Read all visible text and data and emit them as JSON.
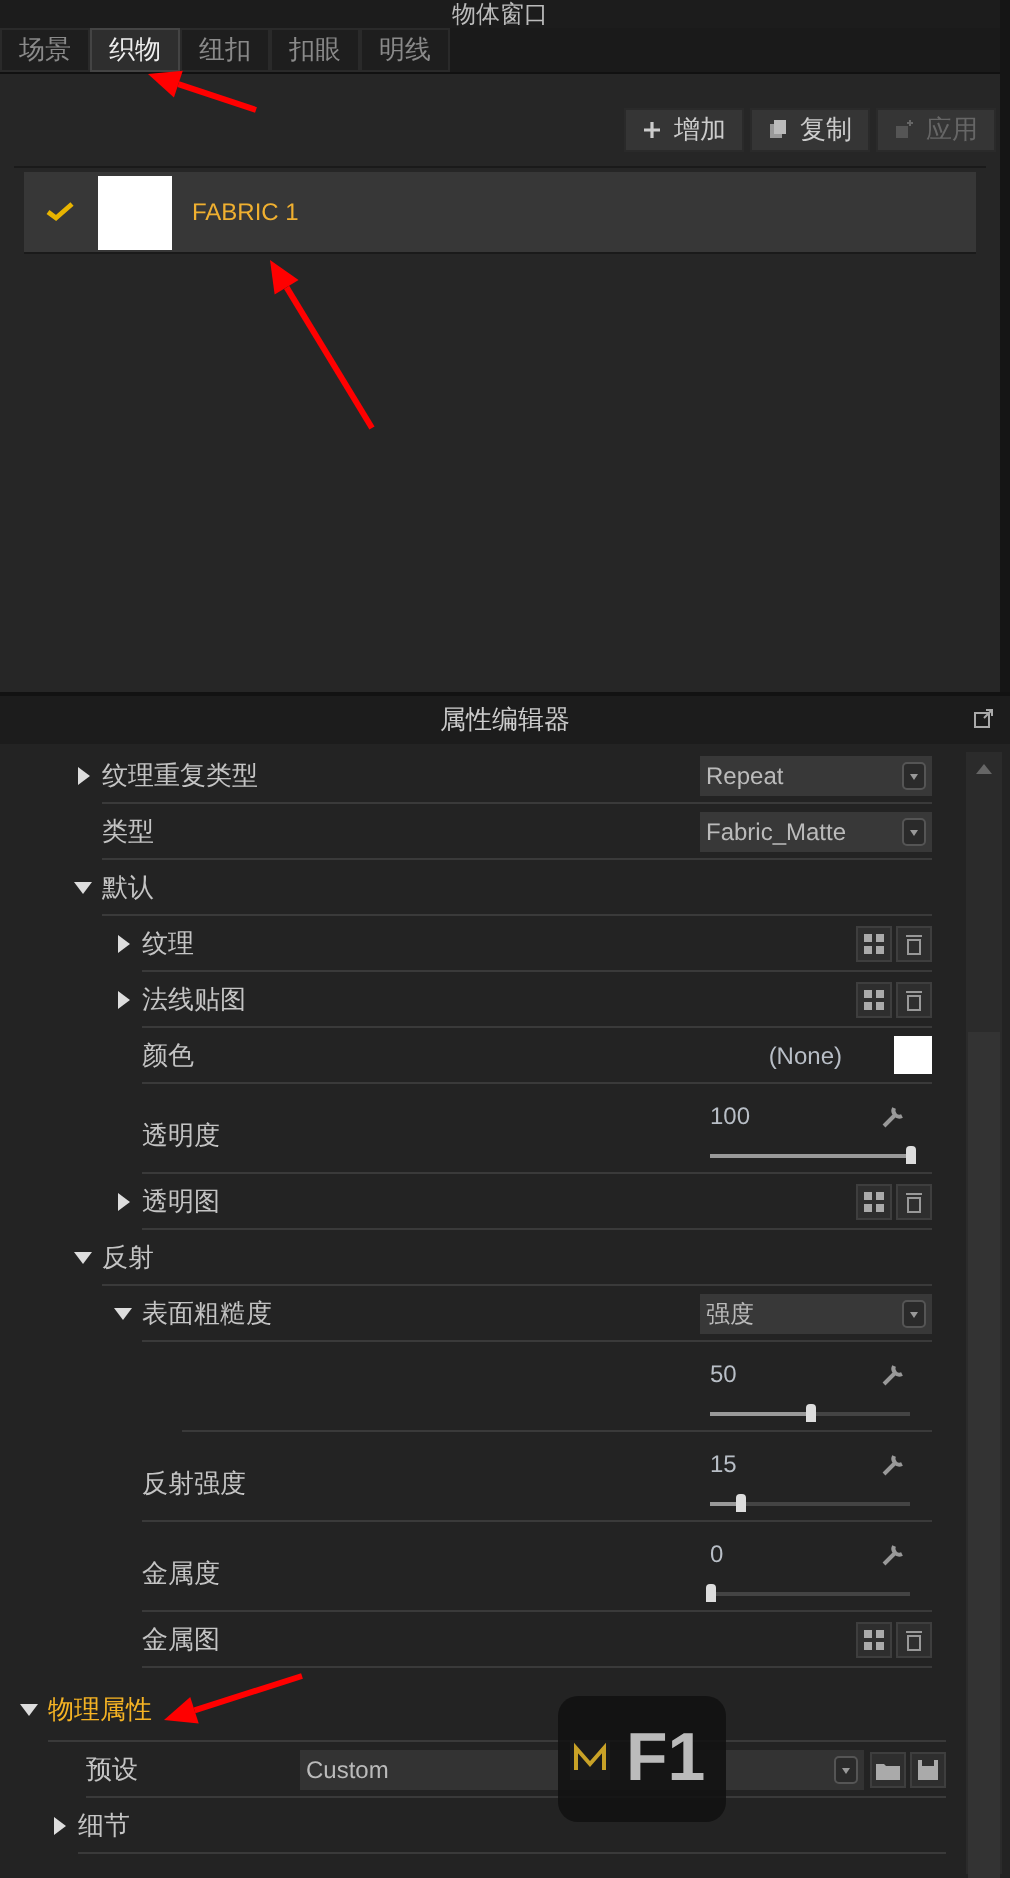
{
  "object_window": {
    "title": "物体窗口",
    "tabs": [
      {
        "label": "场景",
        "selected": false
      },
      {
        "label": "织物",
        "selected": true
      },
      {
        "label": "纽扣",
        "selected": false
      },
      {
        "label": "扣眼",
        "selected": false
      },
      {
        "label": "明线",
        "selected": false
      }
    ],
    "buttons": [
      {
        "label": "增加",
        "kind": "add",
        "disabled": false
      },
      {
        "label": "复制",
        "kind": "copy",
        "disabled": false
      },
      {
        "label": "应用",
        "kind": "apply",
        "disabled": true
      }
    ],
    "fabrics": [
      {
        "name": "FABRIC 1",
        "checked": true,
        "selected": true,
        "color": "#ffffff"
      }
    ]
  },
  "property_editor": {
    "title": "属性编辑器",
    "rows": [
      {
        "kind": "dropdown",
        "label": "纹理重复类型",
        "expanded": false,
        "value": "Repeat"
      },
      {
        "kind": "dropdown",
        "label": "类型",
        "value": "Fabric_Matte"
      },
      {
        "kind": "group",
        "label": "默认",
        "expanded": true,
        "children": [
          {
            "kind": "map",
            "label": "纹理",
            "expanded": false
          },
          {
            "kind": "map",
            "label": "法线贴图",
            "expanded": false
          },
          {
            "kind": "color",
            "label": "颜色",
            "value": "(None)",
            "color": "#ffffff"
          },
          {
            "kind": "slider",
            "label": "透明度",
            "reading": "100",
            "level": 1
          },
          {
            "kind": "map",
            "label": "透明图",
            "expanded": false
          }
        ]
      },
      {
        "kind": "group",
        "label": "反射",
        "expanded": true,
        "children": [
          {
            "kind": "dropdown",
            "label": "表面粗糙度",
            "expanded": true,
            "value": "强度",
            "children": [
              {
                "kind": "slider",
                "reading": "50",
                "level": 0.5
              }
            ]
          },
          {
            "kind": "slider",
            "label": "反射强度",
            "reading": "15",
            "level": 0.15
          },
          {
            "kind": "slider",
            "label": "金属度",
            "reading": "0",
            "level": 0
          },
          {
            "kind": "map",
            "label": "金属图"
          }
        ]
      }
    ],
    "sections": [
      {
        "label": "物理属性",
        "expanded": true,
        "selected": true,
        "children": [
          {
            "kind": "preset",
            "label": "预设",
            "value": "Custom"
          },
          {
            "kind": "group",
            "label": "细节",
            "expanded": false
          }
        ]
      }
    ]
  },
  "key_overlay": {
    "key": "F1"
  }
}
